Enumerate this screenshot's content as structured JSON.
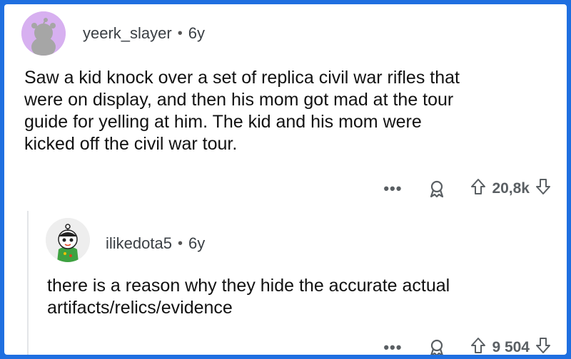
{
  "comments": [
    {
      "username": "yeerk_slayer",
      "age": "6y",
      "text_lines": [
        "Saw a kid knock over a set of replica civil war rifles that",
        "were on display, and then his mom got mad at the tour",
        "guide for yelling at him. The kid and his mom were",
        "kicked off the civil war tour."
      ],
      "more_label": "•••",
      "score": "20,8k",
      "avatar_color": "#d7b0f0"
    },
    {
      "username": "ilikedota5",
      "age": "6y",
      "text_lines": [
        "there is a reason why they hide the accurate actual",
        "artifacts/relics/evidence"
      ],
      "more_label": "•••",
      "score": "9 504",
      "avatar_color": "#eeeeee"
    }
  ],
  "separator": "•",
  "icons": {
    "award": "award-icon",
    "upvote": "upvote-arrow-icon",
    "downvote": "downvote-arrow-icon",
    "more": "more-options-icon"
  },
  "accent": "#1f6fe0"
}
